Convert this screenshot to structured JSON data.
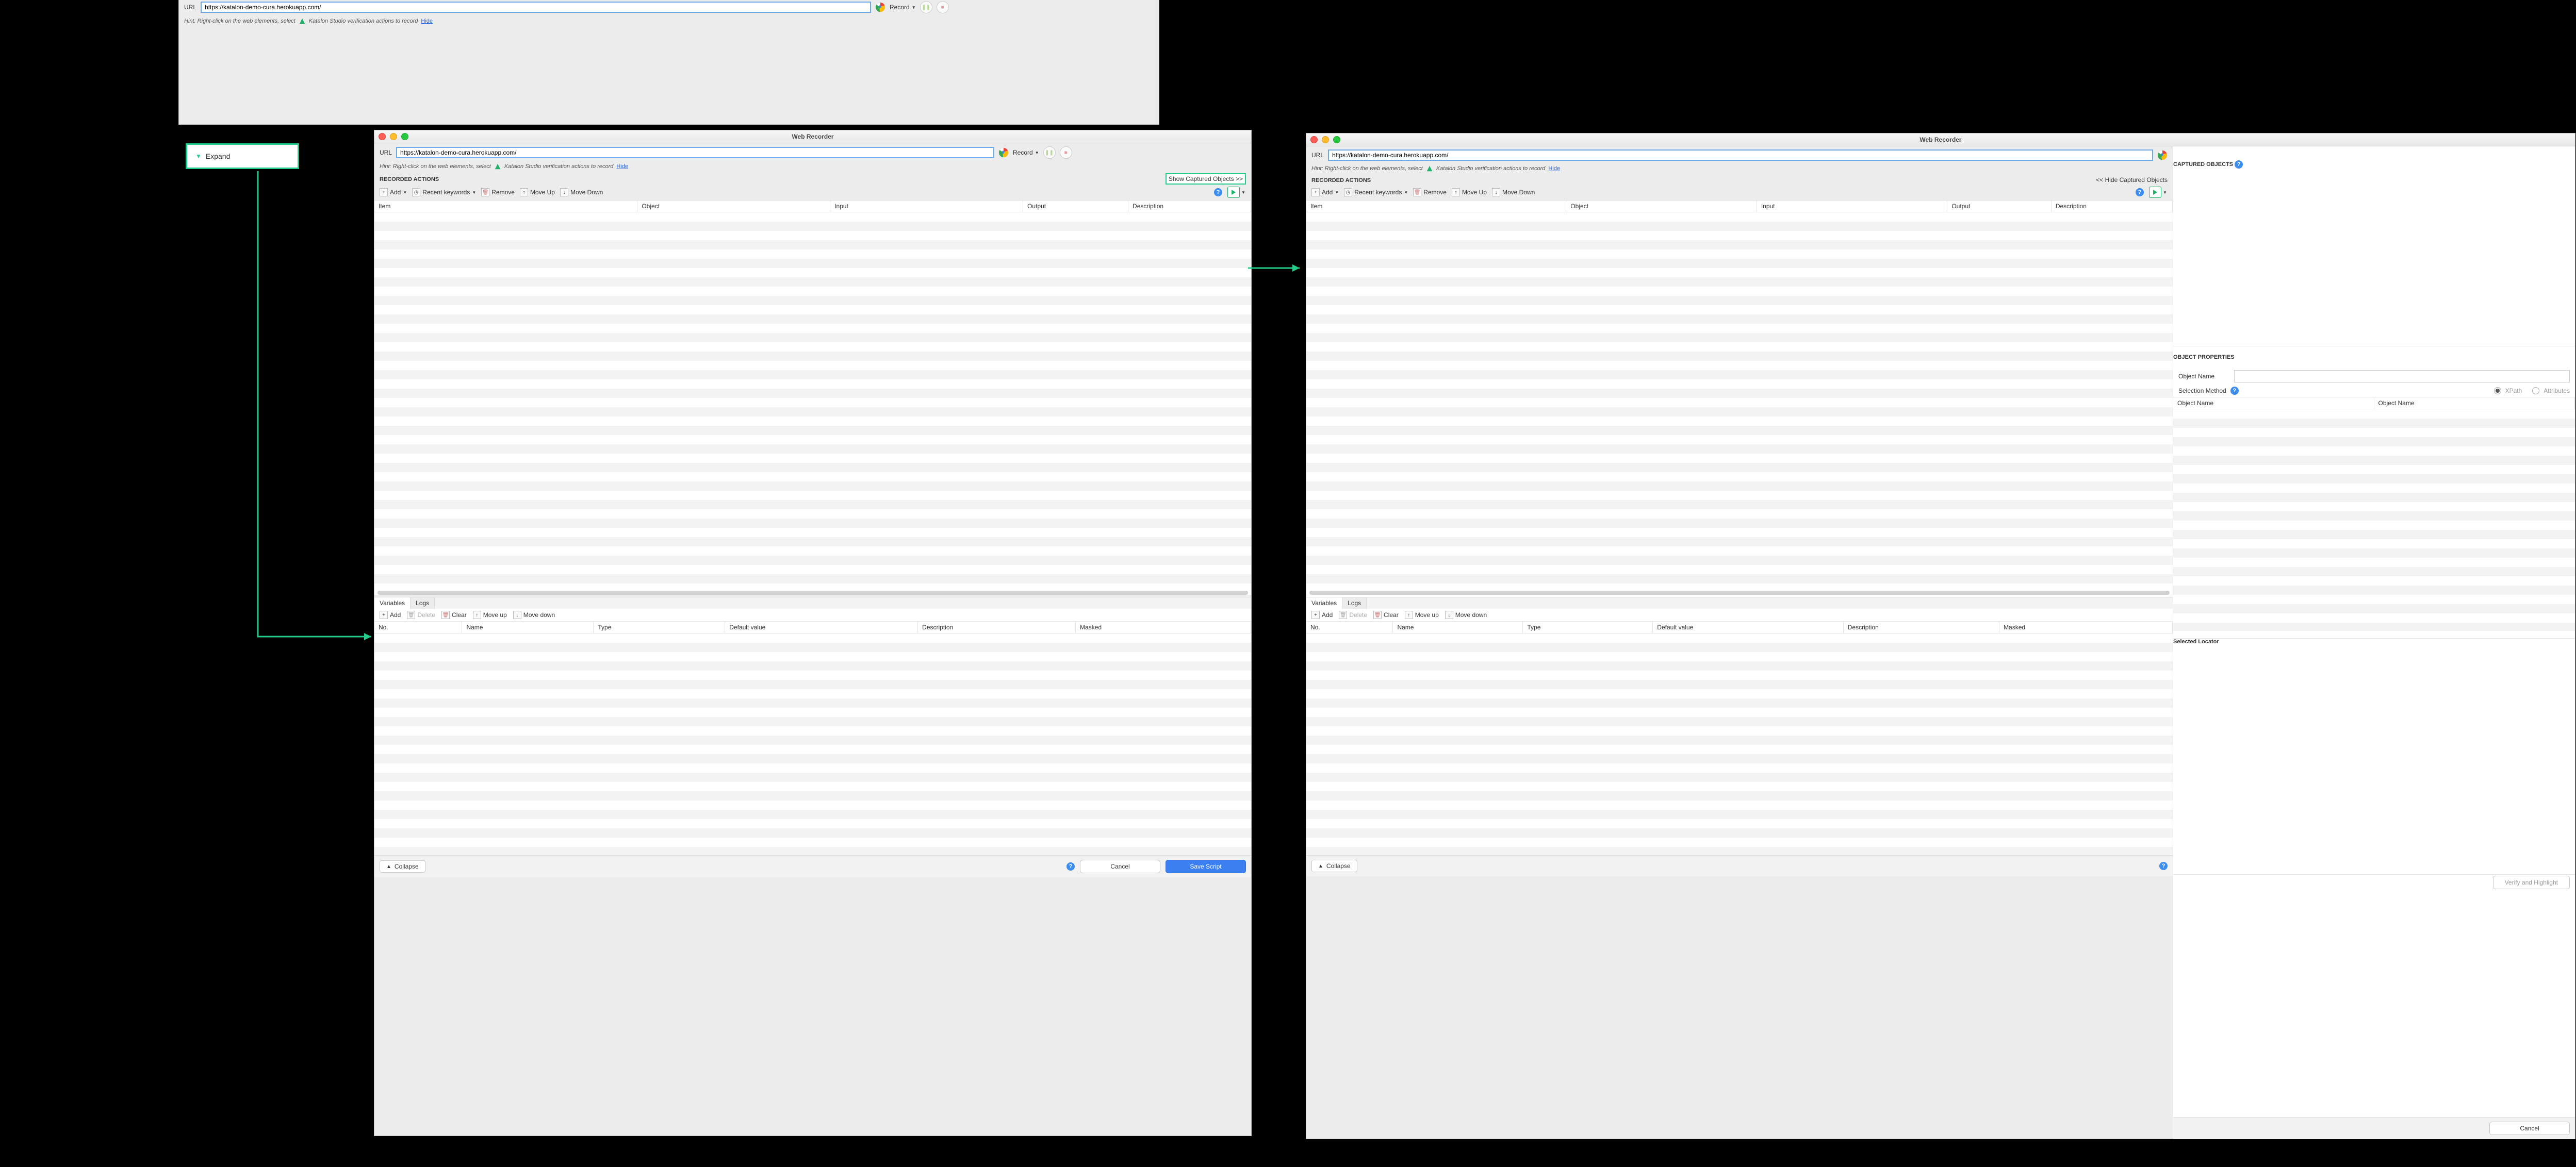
{
  "common": {
    "window_title": "Web Recorder",
    "url_label": "URL",
    "url_value": "https://katalon-demo-cura.herokuapp.com/",
    "record_label": "Record",
    "hint_pre": "Hint: Right-click on the web elements, select",
    "hint_post": "Katalon Studio verification actions to record",
    "hide_label": "Hide",
    "recorded_actions": "RECORDED ACTIONS",
    "toolbar": {
      "add": "Add",
      "recent": "Recent keywords",
      "remove": "Remove",
      "move_up": "Move Up",
      "move_down": "Move Down"
    },
    "cols": {
      "item": "Item",
      "object": "Object",
      "input": "Input",
      "output": "Output",
      "description": "Description"
    },
    "tabs": {
      "variables": "Variables",
      "logs": "Logs"
    },
    "var_toolbar": {
      "add": "Add",
      "delete": "Delete",
      "clear": "Clear",
      "move_up": "Move up",
      "move_down": "Move down"
    },
    "var_cols": {
      "no": "No.",
      "name": "Name",
      "type": "Type",
      "default": "Default value",
      "description": "Description",
      "masked": "Masked"
    },
    "collapse": "Collapse",
    "cancel": "Cancel",
    "save_script": "Save Script"
  },
  "expand_label": "Expand",
  "win2": {
    "show_captured": "Show Captured Objects >>"
  },
  "win3": {
    "hide_captured": "<< Hide Captured Objects",
    "captured_objects": "CAPTURED OBJECTS",
    "object_properties": "OBJECT PROPERTIES",
    "object_name": "Object Name",
    "selection_method": "Selection Method",
    "xpath": "XPath",
    "attributes": "Attributes",
    "selected_locator": "Selected Locator",
    "verify_highlight": "Verify and Highlight"
  }
}
